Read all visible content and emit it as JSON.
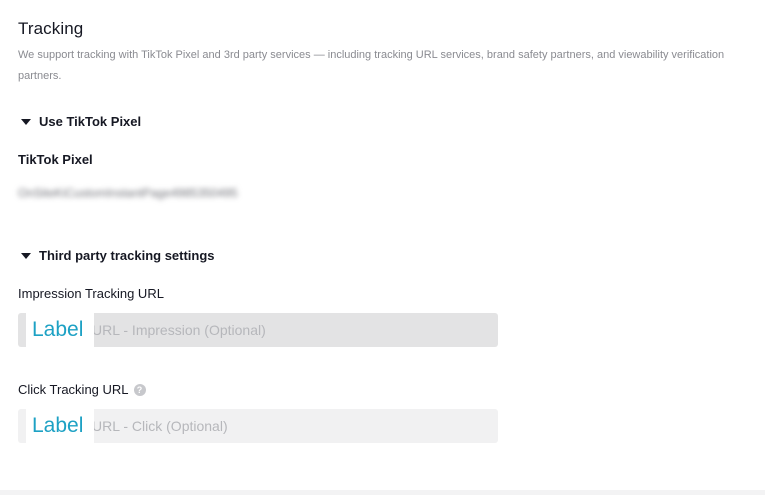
{
  "tracking": {
    "title": "Tracking",
    "description": "We support tracking with TikTok Pixel and 3rd party services — including tracking URL services, brand safety partners, and viewability verification partners."
  },
  "pixel_section": {
    "header": "Use TikTok Pixel",
    "caret_icon": "caret-down-icon",
    "field_label": "TikTok Pixel",
    "value": "OnSiteKiCustomInstantPage4985350495"
  },
  "third_party_section": {
    "header": "Third party tracking settings",
    "caret_icon": "caret-down-icon",
    "impression": {
      "label": "Impression Tracking URL",
      "placeholder": "URL - Impression (Optional)",
      "overlay": "Label"
    },
    "click": {
      "label": "Click Tracking URL",
      "help_icon": "question-circle-icon",
      "help_glyph": "?",
      "placeholder": "URL - Click (Optional)",
      "overlay": "Label"
    }
  },
  "colors": {
    "text_primary": "#161823",
    "text_secondary": "#8a8b91",
    "placeholder": "#b6b7bb",
    "input_bg_active": "#e3e3e4",
    "input_bg": "#f1f1f2",
    "overlay_accent": "#1da1c4"
  }
}
